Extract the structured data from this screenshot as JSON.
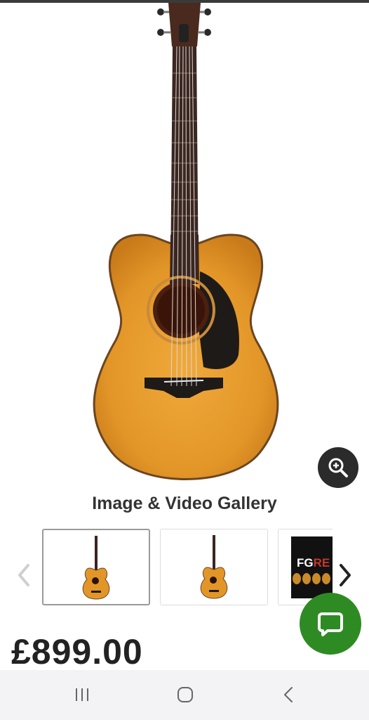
{
  "product": {
    "image_alt": "Acoustic guitar",
    "price": "£899.00"
  },
  "gallery": {
    "title": "Image & Video Gallery",
    "thumbnails": [
      {
        "kind": "image",
        "selected": true
      },
      {
        "kind": "image",
        "selected": false
      },
      {
        "kind": "video",
        "selected": false,
        "poster_text": "FG",
        "poster_text_accent": "RE"
      }
    ]
  },
  "icons": {
    "zoom": "zoom-in-icon",
    "prev": "chevron-left-icon",
    "next": "chevron-right-icon",
    "chat": "chat-bubble-icon",
    "recent": "recent-apps-icon",
    "home": "home-icon",
    "back": "back-icon"
  },
  "colors": {
    "chat_button": "#2e8b23",
    "zoom_button": "#2b2b2b",
    "guitar_top": "#e09a2a",
    "nav_bar": "#f3f3f5"
  }
}
